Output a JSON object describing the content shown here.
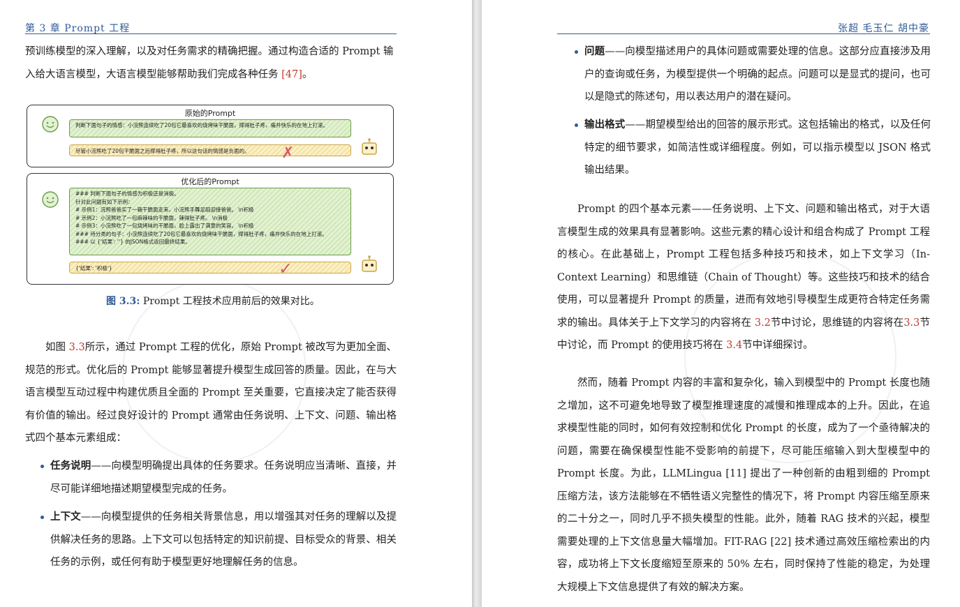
{
  "left_page": {
    "running_head": "第 3 章  Prompt 工程",
    "intro_lines": [
      "预训练模型的深入理解，以及对任务需求的精确把握。通过构造合适的 Prompt 输",
      "入给大语言模型，大语言模型能够帮助我们完成各种任务 "
    ],
    "intro_ref": "[47]",
    "intro_end": "。",
    "figure": {
      "original_title": "原始的Prompt",
      "original_user": "判断下面句子的情感：小浣熊连续吃了20包它最喜欢的烧烤味干脆面，撑得肚子疼，痛并快乐的在地上打滚。",
      "original_reply": "尽管小浣熊吃了20包干脆面之后撑得肚子疼，所以这句话的情感是负面的。",
      "optimized_title": "优化后的Prompt",
      "optimized_user_lines": [
        "### 判断下面句子的情感为积极还是消极。",
        "针对此问题有如下示例：",
        "# 示例1：浣熊爸爸买了一箱干脆面走来，小浣熊手舞足蹈迎接爸爸。 \\n积极",
        "# 示例2：小浣熊吃了一包麻辣味的干脆面，辣得肚子疼。 \\n消极",
        "# 示例3：小浣熊吃了一包烧烤味的干脆面，脸上露出了满意的笑容。 \\n积极",
        "### 待分类的句子：小浣熊连续吃了20包它最喜欢的烧烤味干脆面，撑得肚子疼，痛并快乐的在地上打滚。",
        "### 以 {'结果': ''} 的JSON格式返回最终结果。"
      ],
      "optimized_reply": "{'结果': '积极'}",
      "wrong_mark": "✗",
      "right_mark": "✓"
    },
    "caption_label": "图 3.3:",
    "caption_text": " Prompt 工程技术应用前后的效果对比。",
    "para2": {
      "p1": "如图 ",
      "ref": "3.3",
      "p2": "所示，通过 Prompt 工程的优化，原始 Prompt 被改写为更加全面、规范的形式。优化后的 Prompt 能够显著提升模型生成回答的质量。因此，在与大语言模型互动过程中构建优质且全面的 Prompt 至关重要，它直接决定了能否获得有价值的输出。经过良好设计的 Prompt 通常由任务说明、上下文、问题、输出格式四个基本元素组成："
    },
    "bullets": [
      {
        "term": "任务说明",
        "text": "——向模型明确提出具体的任务要求。任务说明应当清晰、直接，并尽可能详细地描述期望模型完成的任务。"
      },
      {
        "term": "上下文",
        "text": "——向模型提供的任务相关背景信息，用以增强其对任务的理解以及提供解决任务的思路。上下文可以包括特定的知识前提、目标受众的背景、相关任务的示例，或任何有助于模型更好地理解任务的信息。"
      }
    ]
  },
  "right_page": {
    "running_head": "张超 毛玉仁 胡中豪",
    "bullets": [
      {
        "term": "问题",
        "text": "——向模型描述用户的具体问题或需要处理的信息。这部分应直接涉及用户的查询或任务，为模型提供一个明确的起点。问题可以是显式的提问，也可以是隐式的陈述句，用以表达用户的潜在疑问。"
      },
      {
        "term": "输出格式",
        "text": "——期望模型给出的回答的展示形式。这包括输出的格式，以及任何特定的细节要求，如简洁性或详细程度。例如，可以指示模型以 JSON 格式输出结果。"
      }
    ],
    "para1": {
      "p1": "Prompt 的四个基本元素——任务说明、上下文、问题和输出格式，对于大语言模型生成的效果具有显著影响。这些元素的精心设计和组合构成了 Prompt 工程的核心。在此基础上，Prompt 工程包括多种技巧和技术，如上下文学习（In-Context Learning）和思维链（Chain of Thought）等。这些技巧和技术的结合使用，可以显著提升 Prompt 的质量，进而有效地引导模型生成更符合特定任务需求的输出。具体关于上下文学习的内容将在 ",
      "ref1": "3.2",
      "p2": "节中讨论，思维链的内容将在",
      "ref2": "3.3",
      "p3": "节中讨论，而 Prompt 的使用技巧将在 ",
      "ref3": "3.4",
      "p4": "节中详细探讨。"
    },
    "para2": {
      "p1": "然而，随着 Prompt 内容的丰富和复杂化，输入到模型中的 Prompt 长度也随之增加，这不可避免地导致了模型推理速度的减慢和推理成本的上升。因此，在追求模型性能的同时，如何有效控制和优化 Prompt 的长度，成为了一个亟待解决的问题，需要在确保模型性能不受影响的前提下，尽可能压缩输入到大型模型中的 Prompt 长度。为此，LLMLingua ",
      "ref1": "[11]",
      "p2": " 提出了一种创新的由粗到细的 Prompt 压缩方法，该方法能够在不牺牲语义完整性的情况下，将 Prompt 内容压缩至原来的二十分之一，同时几乎不损失模型的性能。此外，随着 RAG 技术的兴起，模型需要处理的上下文信息量大幅增加。FIT-RAG ",
      "ref2": "[22]",
      "p3": " 技术通过高效压缩检索出的内容，成功将上下文长度缩短至原来的 50% 左右，同时保持了性能的稳定，为处理大规模上下文信息提供了有效的解决方案。"
    }
  },
  "colors": {
    "accent": "#2f5a96",
    "ref": "#c0392b",
    "green": "#6a9b4a",
    "yellow": "#c9a64a"
  }
}
